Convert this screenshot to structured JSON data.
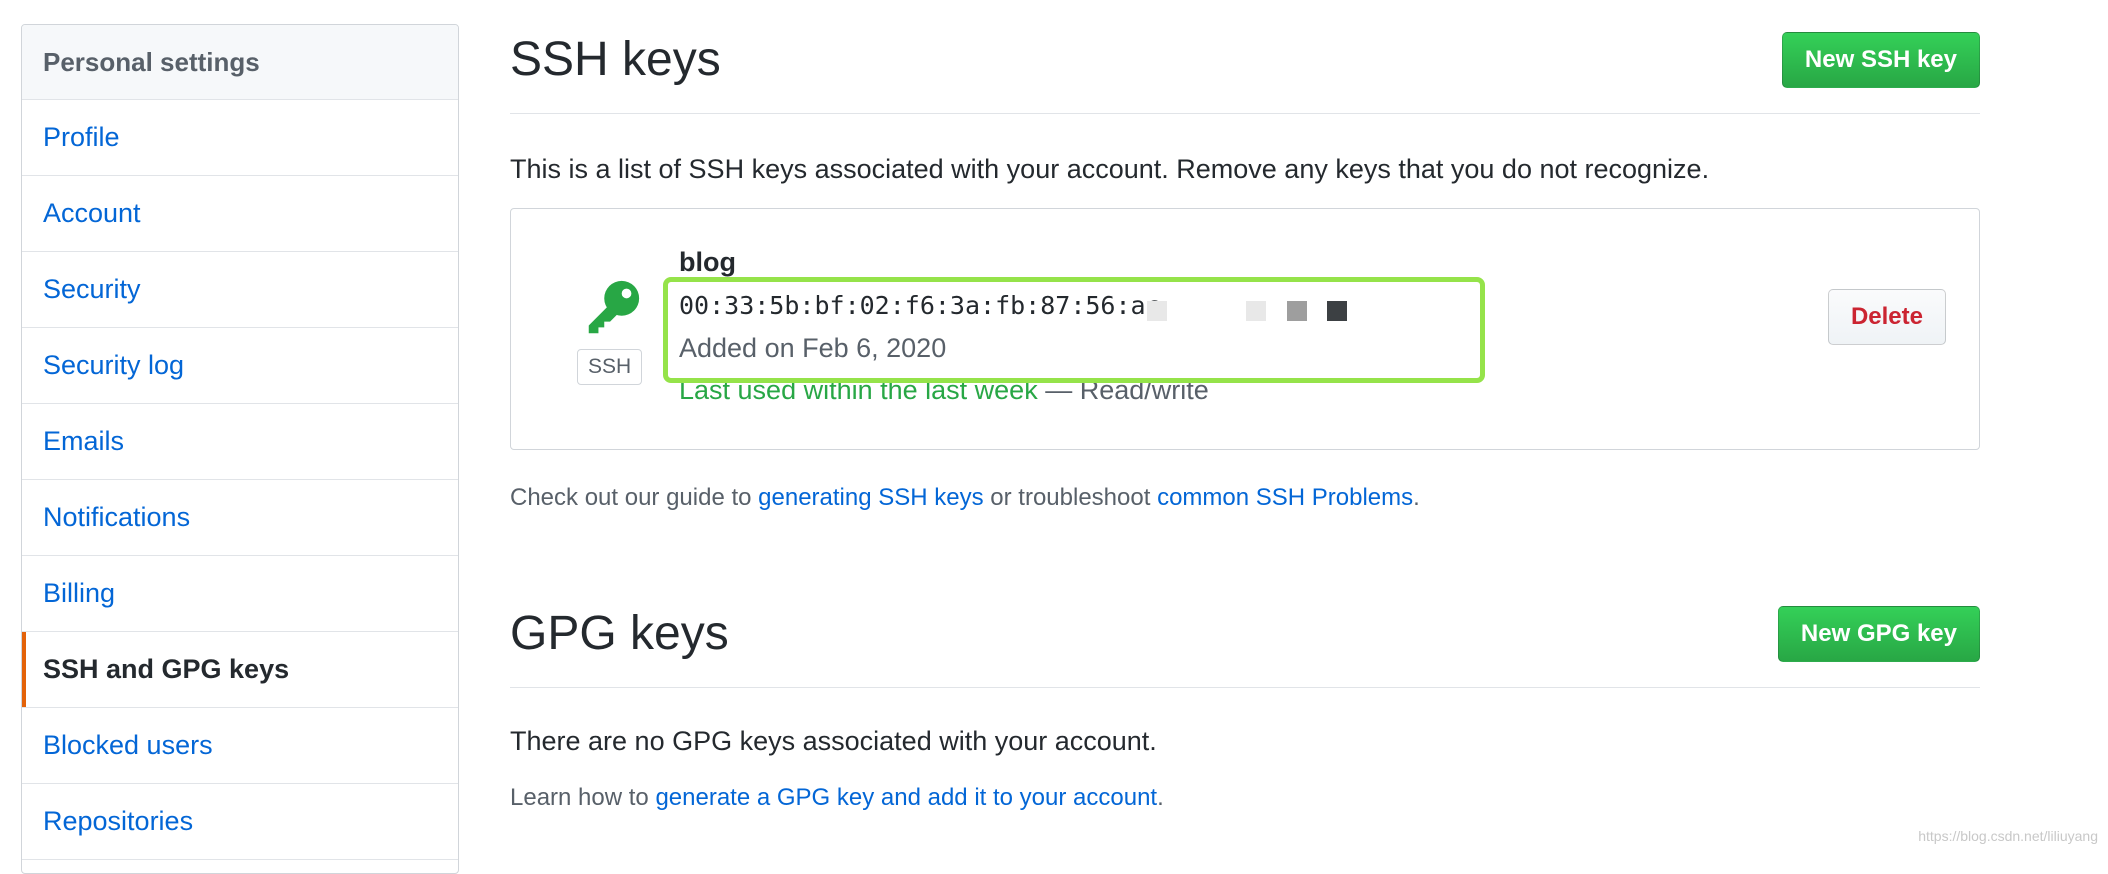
{
  "sidebar": {
    "header": "Personal settings",
    "items": [
      {
        "label": "Profile"
      },
      {
        "label": "Account"
      },
      {
        "label": "Security"
      },
      {
        "label": "Security log"
      },
      {
        "label": "Emails"
      },
      {
        "label": "Notifications"
      },
      {
        "label": "Billing"
      },
      {
        "label": "SSH and GPG keys",
        "selected": true
      },
      {
        "label": "Blocked users"
      },
      {
        "label": "Repositories"
      }
    ]
  },
  "ssh": {
    "title": "SSH keys",
    "new_button": "New SSH key",
    "intro": "This is a list of SSH keys associated with your account. Remove any keys that you do not recognize.",
    "key": {
      "type_label": "SSH",
      "title": "blog",
      "fingerprint": "00:33:5b:bf:02:f6:3a:fb:87:56:ac",
      "added": "Added on Feb 6, 2020",
      "last_used": "Last used within the last week",
      "access": " — Read/write",
      "delete_button": "Delete"
    },
    "guide": {
      "prefix": "Check out our guide to ",
      "link1": "generating SSH keys",
      "middle": " or troubleshoot ",
      "link2": "common SSH Problems",
      "suffix": "."
    }
  },
  "gpg": {
    "title": "GPG keys",
    "new_button": "New GPG key",
    "empty": "There are no GPG keys associated with your account.",
    "learn_prefix": "Learn how to ",
    "learn_link": "generate a GPG key and add it to your account",
    "learn_suffix": "."
  },
  "watermark": "https://blog.csdn.net/liliuyang",
  "colors": {
    "link": "#0366d6",
    "primary_green": "#28a745",
    "danger_red": "#cb2431",
    "selected_marker": "#e36209",
    "highlight_outline": "#95e34a"
  },
  "icons": {
    "key": "key-icon"
  }
}
